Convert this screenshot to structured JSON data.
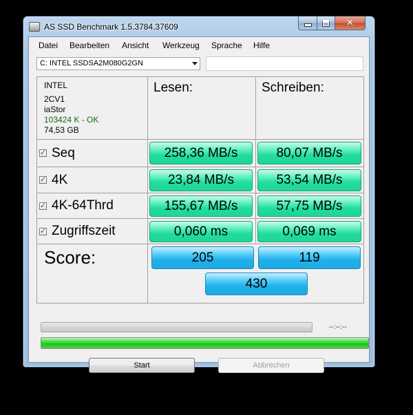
{
  "window": {
    "title": "AS SSD Benchmark 1.5.3784.37609",
    "close_glyph": "✕"
  },
  "menu": [
    "Datei",
    "Bearbeiten",
    "Ansicht",
    "Werkzeug",
    "Sprache",
    "Hilfe"
  ],
  "drive": {
    "selected": "C: INTEL SSDSA2M080G2GN",
    "extra_text": ""
  },
  "info": {
    "vendor": "INTEL",
    "firmware": "2CV1",
    "driver": "iaStor",
    "alignment": "103424 K - OK",
    "size": "74,53 GB"
  },
  "headers": {
    "read": "Lesen:",
    "write": "Schreiben:"
  },
  "rows": [
    {
      "label": "Seq",
      "read": "258,36 MB/s",
      "write": "80,07 MB/s",
      "checked": true
    },
    {
      "label": "4K",
      "read": "23,84 MB/s",
      "write": "53,54 MB/s",
      "checked": true
    },
    {
      "label": "4K-64Thrd",
      "read": "155,67 MB/s",
      "write": "57,75 MB/s",
      "checked": true
    },
    {
      "label": "Zugriffszeit",
      "read": "0,060 ms",
      "write": "0,069 ms",
      "checked": true
    }
  ],
  "score": {
    "label": "Score:",
    "read": "205",
    "write": "119",
    "total": "430"
  },
  "progress": {
    "time": "--:--:--",
    "test_progress": 1.0,
    "overall_progress": 1.0
  },
  "buttons": {
    "start": "Start",
    "cancel": "Abbrechen"
  },
  "colors": {
    "result_green": "#22dca0",
    "score_blue": "#21b0ea",
    "progress_green": "#22c222"
  }
}
